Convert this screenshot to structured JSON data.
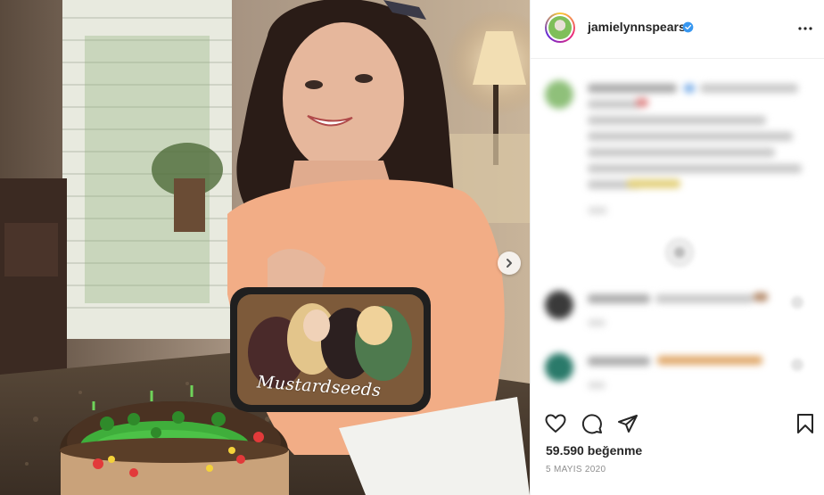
{
  "post": {
    "username": "jamielynnspears",
    "verified_icon": "verified-badge-icon",
    "more_icon": "more-options-icon",
    "image_text": "Mustardseeds",
    "next_icon": "chevron-right-icon",
    "likes_text": "59.590 beğenme",
    "date_text": "5 MAYIS 2020"
  },
  "actions": {
    "like_icon": "heart-icon",
    "comment_icon": "comment-icon",
    "share_icon": "share-icon",
    "save_icon": "bookmark-icon"
  },
  "colors": {
    "accent_verified": "#3897f0",
    "text_primary": "#262626",
    "text_secondary": "#8e8e8e",
    "border": "#efefef"
  }
}
